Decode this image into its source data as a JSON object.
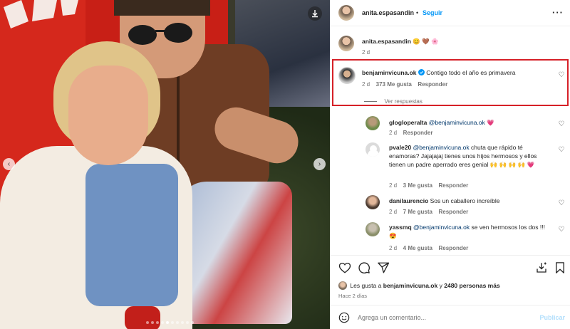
{
  "post": {
    "author": "anita.espasandin",
    "dot": "•",
    "follow_label": "Seguir",
    "caption": {
      "username": "anita.espasandin",
      "text": "😊 🤎 🌸",
      "time": "2 d"
    }
  },
  "media": {
    "download_icon": "download-icon",
    "carousel_count": 10,
    "carousel_active": 4
  },
  "comments": [
    {
      "username": "benjaminvicuna.ok",
      "verified": true,
      "text": "Contigo todo el año es primavera",
      "time": "2 d",
      "likes": "373 Me gusta",
      "reply": "Responder",
      "view_replies": "Ver respuestas",
      "highlighted": true
    },
    {
      "username": "glogloperalta",
      "mention": "@benjaminvicuna.ok",
      "text": "💗",
      "time": "2 d",
      "reply": "Responder"
    },
    {
      "username": "pvale20",
      "mention": "@benjaminvicuna.ok",
      "text": "chuta que rápido té enamoras? Jajajajaj tienes unos hijos hermosos y ellos tienen un padre aperrado eres genial 🙌 🙌 🙌 🙌 💗",
      "time": "2 d",
      "likes": "3 Me gusta",
      "reply": "Responder"
    },
    {
      "username": "danilaurencio",
      "text": "Sos un caballero increíble",
      "time": "2 d",
      "likes": "7 Me gusta",
      "reply": "Responder"
    },
    {
      "username": "yassmq",
      "mention": "@benjaminvicuna.ok",
      "text": "se ven hermosos los dos !!! 😍",
      "time": "2 d",
      "likes": "4 Me gusta",
      "reply": "Responder"
    }
  ],
  "likes": {
    "prefix": "Les gusta a",
    "user": "benjaminvicuna.ok",
    "connector": "y",
    "others": "2480 personas más",
    "time": "Hace 2 días"
  },
  "composer": {
    "placeholder": "Agrega un comentario...",
    "post_label": "Publicar"
  },
  "colors": {
    "accent": "#0095f6",
    "highlight_border": "#d62027",
    "like_red": "#ed4956",
    "muted": "#737373"
  }
}
